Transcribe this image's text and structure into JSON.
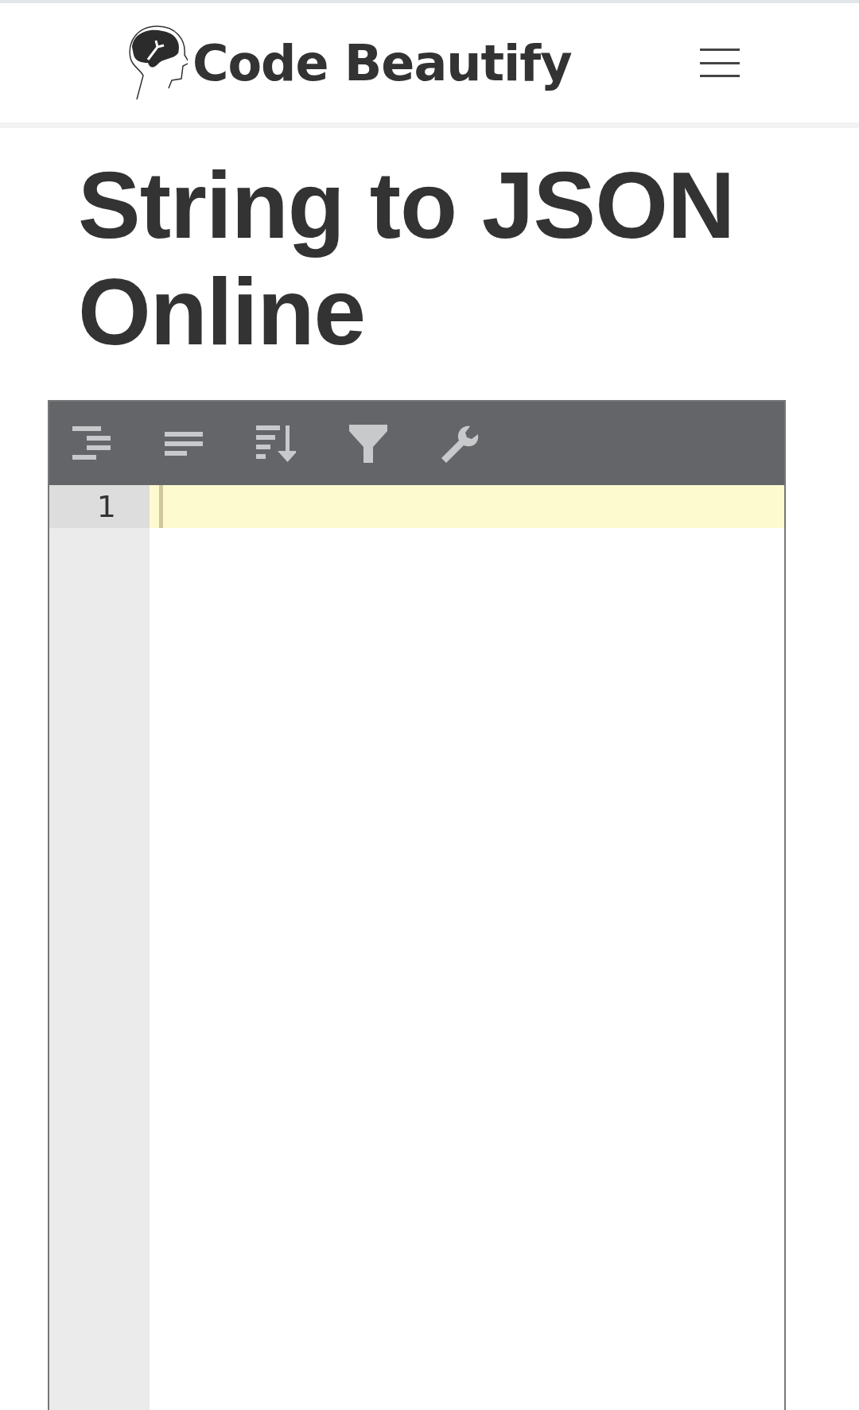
{
  "header": {
    "logo_text": "Code Beautify"
  },
  "title": "String to JSON Online",
  "editor": {
    "toolbar": [
      {
        "kind": "indent"
      },
      {
        "kind": "compact"
      },
      {
        "kind": "sort"
      },
      {
        "kind": "filter"
      },
      {
        "kind": "repair"
      }
    ],
    "lines": [
      {
        "number": "1",
        "active": true
      }
    ]
  }
}
